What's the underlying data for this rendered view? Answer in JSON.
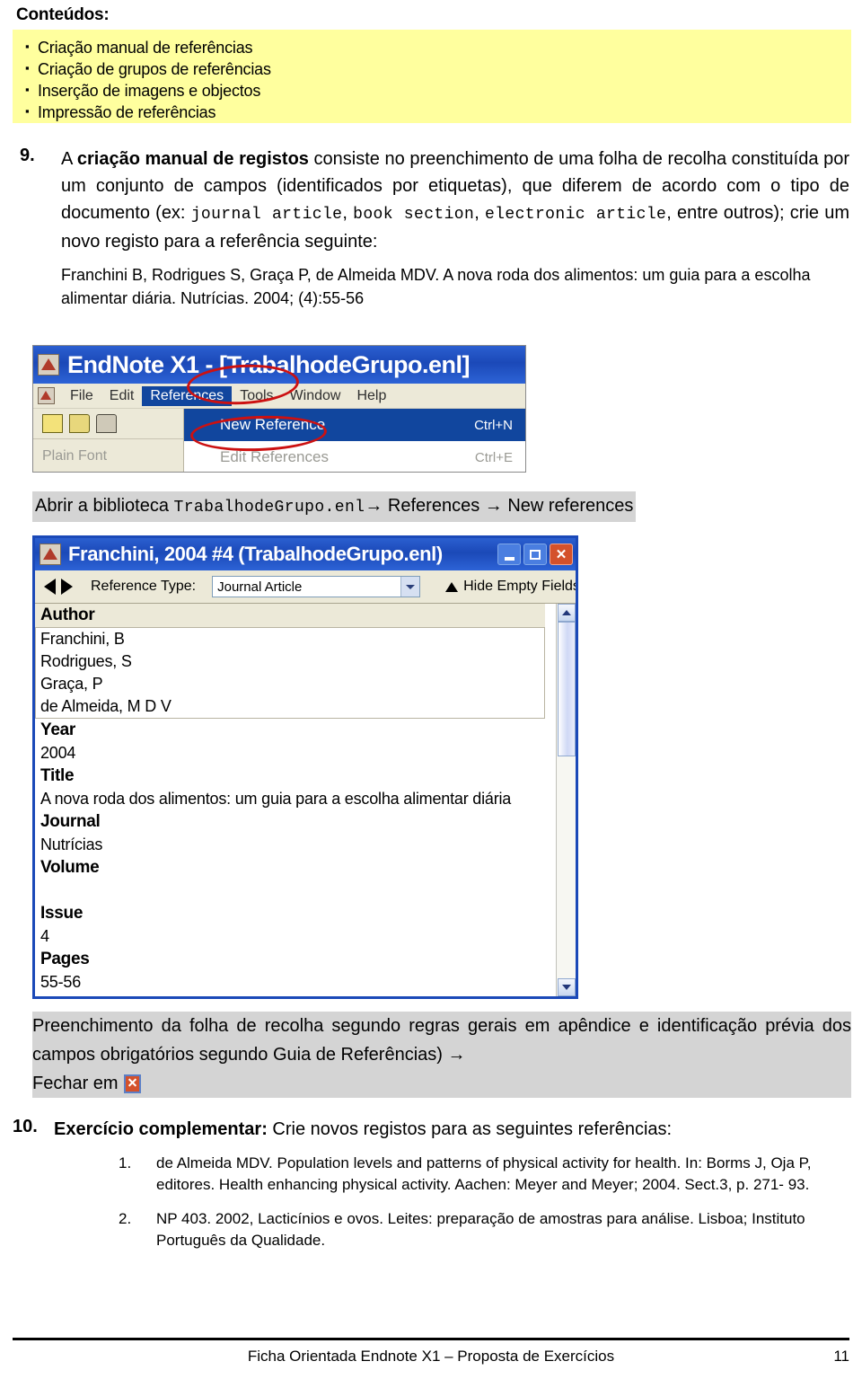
{
  "header": {
    "title": "Conteúdos:",
    "bullets": [
      "Criação manual de referências",
      "Criação de grupos de referências",
      "Inserção de imagens e objectos",
      "Impressão de referências"
    ]
  },
  "item9": {
    "number": "9.",
    "text_a": "A ",
    "text_bold": "criação manual de registos",
    "text_b": " consiste no preenchimento de uma folha de recolha constituída por um conjunto de campos (identificados por etiquetas), que diferem de acordo com o tipo de documento (ex: ",
    "mono_1": "journal article",
    "text_c": ", ",
    "mono_2": "book section",
    "text_d": ", ",
    "mono_3": "electronic article",
    "text_e": ", entre outros); crie um novo registo para a referência seguinte:",
    "reference": "Franchini B, Rodrigues S, Graça P, de Almeida MDV. A nova roda dos alimentos: um guia para a escolha alimentar diária. Nutrícias. 2004; (4):55-56"
  },
  "screenshot1": {
    "title": "EndNote X1 - [TrabalhodeGrupo.enl]",
    "menus": [
      "File",
      "Edit",
      "References",
      "Tools",
      "Window",
      "Help"
    ],
    "selected_menu": "References",
    "font_label": "Plain Font",
    "dropdown_items": [
      {
        "label": "New Reference",
        "shortcut": "Ctrl+N",
        "state": "highlighted"
      },
      {
        "label": "Edit References",
        "shortcut": "Ctrl+E",
        "state": "disabled"
      }
    ],
    "annotation_color": "#cc1111"
  },
  "caption1": {
    "prefix": "Abrir a biblioteca ",
    "mono": "TrabalhodeGrupo.enl",
    "arrow1": "→",
    "mid": " References ",
    "arrow2": "→",
    "suffix": " New references"
  },
  "screenshot2": {
    "title": "Franchini, 2004 #4 (TrabalhodeGrupo.enl)",
    "window_buttons": [
      "minimize",
      "maximize",
      "close"
    ],
    "toolbar": {
      "reference_type_label": "Reference Type:",
      "reference_type_value": "Journal Article",
      "hide_empty_fields": "Hide Empty Fields"
    },
    "fields": [
      {
        "label": "Author",
        "value": "Franchini, B\nRodrigues, S\nGraça, P\nde Almeida, M D V",
        "active": true
      },
      {
        "label": "Year",
        "value": "2004",
        "active": false
      },
      {
        "label": "Title",
        "value": "A nova roda dos alimentos: um guia para a escolha alimentar diária",
        "active": false
      },
      {
        "label": "Journal",
        "value": "Nutrícias",
        "active": false
      },
      {
        "label": "Volume",
        "value": "",
        "active": false
      },
      {
        "label": "Issue",
        "value": "4",
        "active": false
      },
      {
        "label": "Pages",
        "value": "55-56",
        "active": false
      }
    ]
  },
  "caption2": {
    "line1": "Preenchimento da folha de recolha segundo regras gerais em apêndice e identificação prévia dos campos obrigatórios segundo Guia de Referências) ",
    "arrow": "→",
    "line2": "Fechar em "
  },
  "item10": {
    "number": "10.",
    "head_bold": "Exercício complementar:",
    "head_rest": " Crie novos registos para as seguintes referências:",
    "items": [
      {
        "num": "1.",
        "text": "de Almeida MDV. Population levels and patterns of physical activity for health. In: Borms J, Oja P, editores.  Health enhancing physical activity.  Aachen: Meyer and Meyer; 2004. Sect.3, p. 271- 93."
      },
      {
        "num": "2.",
        "text": "NP 403. 2002, Lacticínios e ovos. Leites: preparação de amostras para análise. Lisboa; Instituto Português da Qualidade."
      }
    ]
  },
  "footer": {
    "text": "Ficha Orientada Endnote X1 – Proposta de Exercícios",
    "page": "11"
  },
  "colors": {
    "highlight_yellow": "#ffff9e",
    "highlight_grey": "#d4d4d4",
    "titlebar_blue": "#1b49b8",
    "annotation_red": "#cc1111",
    "menu_beige": "#ece9d8"
  }
}
